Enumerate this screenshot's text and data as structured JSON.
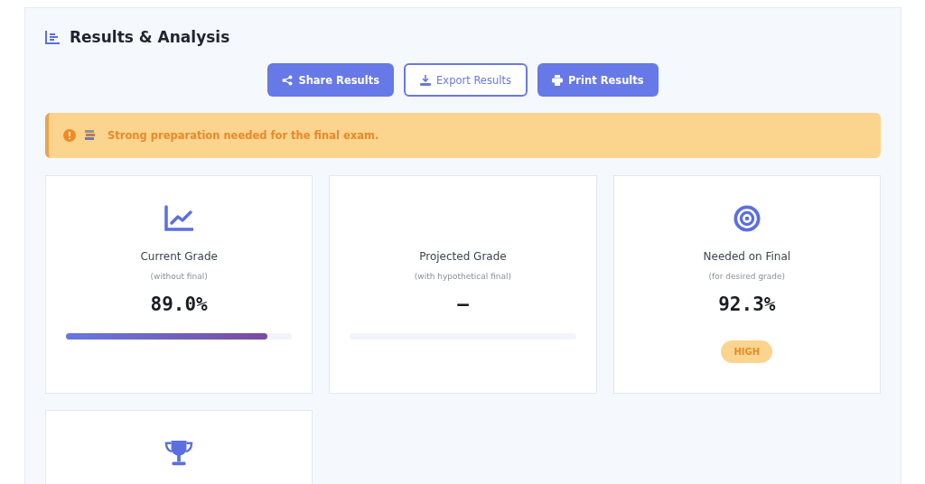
{
  "header": {
    "title": "Results & Analysis"
  },
  "buttons": [
    {
      "label": "Share Results",
      "kind": "share"
    },
    {
      "label": "Export Results",
      "kind": "export"
    },
    {
      "label": "Print Results",
      "kind": "print"
    }
  ],
  "alert": {
    "message": "Strong preparation needed for the final exam."
  },
  "cards": [
    {
      "kind": "chart",
      "title": "Current Grade",
      "subtitle": "(without final)",
      "value": "89.0%",
      "level": 0.89
    },
    {
      "kind": "plain",
      "title": "Projected Grade",
      "subtitle": "(with hypothetical final)",
      "value": "–"
    },
    {
      "kind": "target",
      "title": "Needed on Final",
      "subtitle": "(for desired grade)",
      "value": "92.3%",
      "badge": "HIGH"
    },
    {
      "kind": "trophy"
    }
  ]
}
